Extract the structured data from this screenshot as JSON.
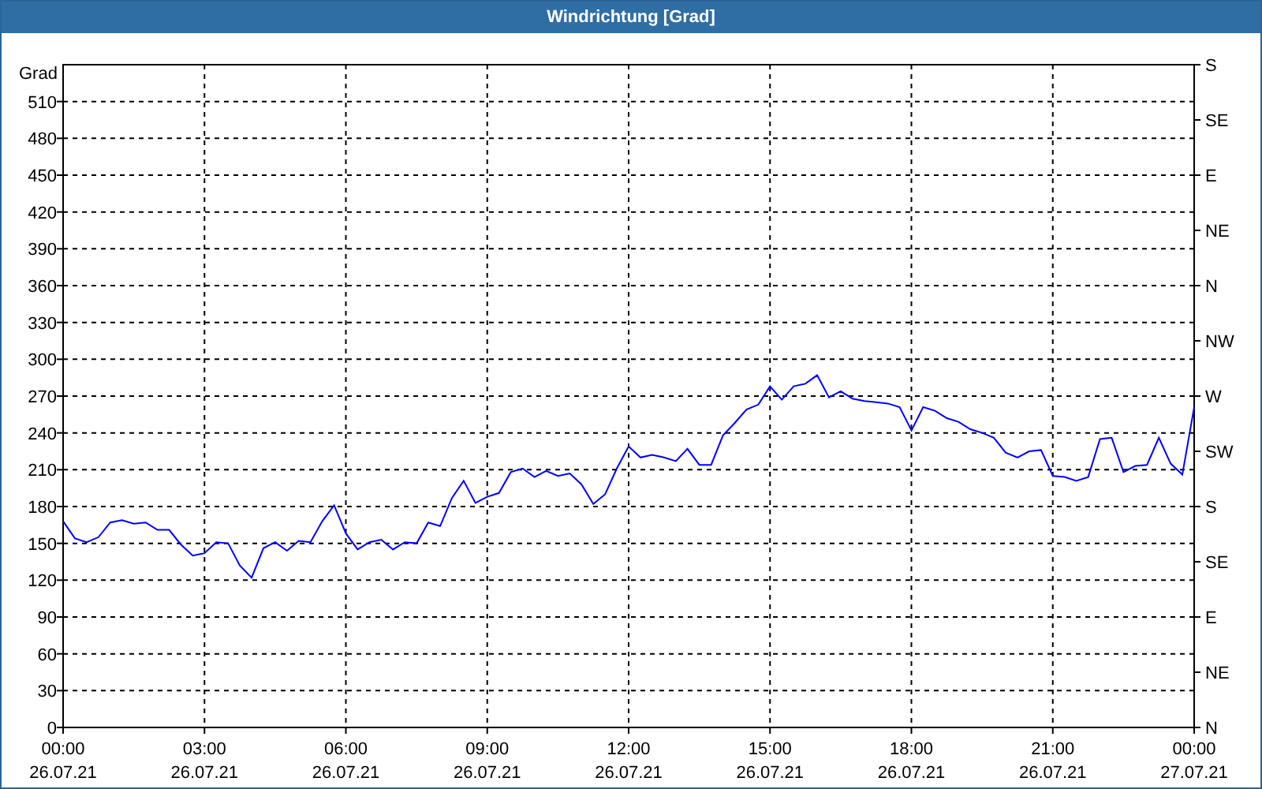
{
  "window": {
    "title": "Windrichtung [Grad]"
  },
  "chart": {
    "chart_data": {
      "type": "line",
      "grid": true,
      "ylabel": "Grad",
      "ylim": [
        0,
        540
      ],
      "yticks": [
        0,
        30,
        60,
        90,
        120,
        150,
        180,
        210,
        240,
        270,
        300,
        330,
        360,
        390,
        420,
        450,
        480,
        510
      ],
      "categories": [
        "00:00\n26.07.21",
        null,
        null,
        null,
        null,
        null,
        null,
        null,
        null,
        null,
        null,
        null,
        "03:00\n26.07.21",
        null,
        null,
        null,
        null,
        null,
        null,
        null,
        null,
        null,
        null,
        null,
        "06:00\n26.07.21",
        null,
        null,
        null,
        null,
        null,
        null,
        null,
        null,
        null,
        null,
        null,
        "09:00\n26.07.21",
        null,
        null,
        null,
        null,
        null,
        null,
        null,
        null,
        null,
        null,
        null,
        "12:00\n26.07.21",
        null,
        null,
        null,
        null,
        null,
        null,
        null,
        null,
        null,
        null,
        null,
        "15:00\n26.07.21",
        null,
        null,
        null,
        null,
        null,
        null,
        null,
        null,
        null,
        null,
        null,
        "18:00\n26.07.21",
        null,
        null,
        null,
        null,
        null,
        null,
        null,
        null,
        null,
        null,
        null,
        "21:00\n26.07.21",
        null,
        null,
        null,
        null,
        null,
        null,
        null,
        null,
        null,
        null,
        null,
        "00:00\n27.07.21"
      ],
      "series": [
        {
          "color": "#0000ff",
          "values": [
            168,
            154,
            151,
            155,
            167,
            169,
            166,
            167,
            161,
            161,
            149,
            140,
            142,
            151,
            150,
            132,
            122,
            146,
            151,
            144,
            152,
            151,
            168,
            181,
            158,
            145,
            151,
            153,
            145,
            151,
            150,
            167,
            164,
            187,
            201,
            183,
            188,
            191,
            208,
            211,
            204,
            209,
            205,
            207,
            198,
            182,
            190,
            211,
            229,
            220,
            222,
            220,
            217,
            227,
            214,
            214,
            238,
            248,
            259,
            263,
            278,
            267,
            278,
            280,
            287,
            269,
            274,
            268,
            266,
            265,
            264,
            261,
            242,
            261,
            258,
            252,
            249,
            243,
            240,
            236,
            224,
            220,
            225,
            226,
            205,
            204,
            201,
            204,
            235,
            236,
            208,
            213,
            214,
            236,
            215,
            206,
            261
          ]
        }
      ]
    },
    "right_axis": {
      "labels": [
        "S",
        "SE",
        "E",
        "NE",
        "N",
        "NW",
        "W",
        "SW",
        "S",
        "SE",
        "E",
        "NE",
        "N"
      ]
    }
  }
}
